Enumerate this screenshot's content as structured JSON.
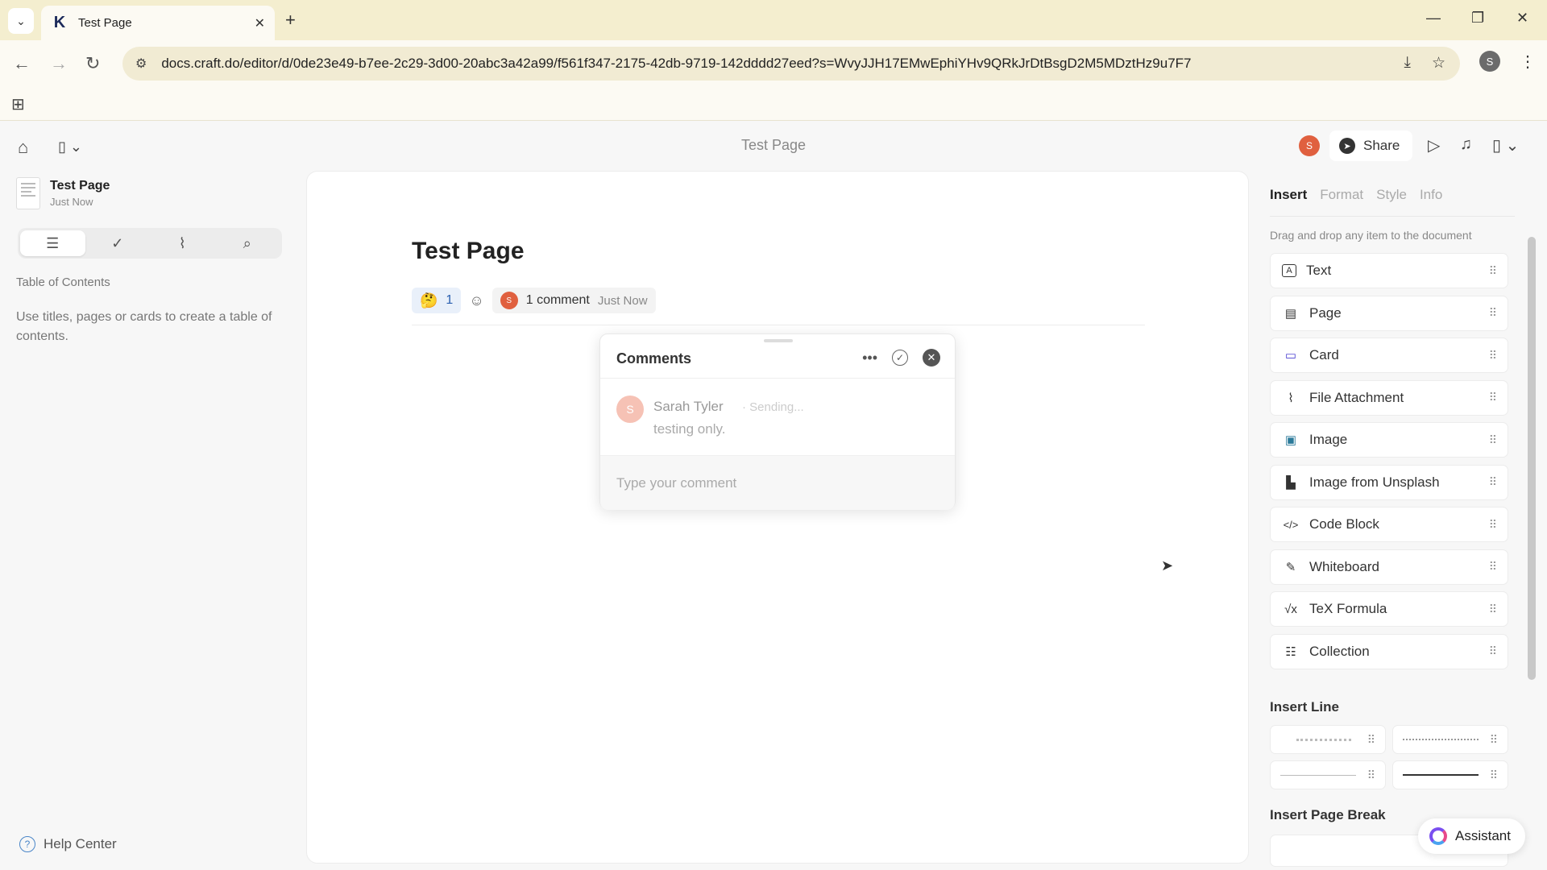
{
  "browser": {
    "tab_title": "Test Page",
    "url": "docs.craft.do/editor/d/0de23e49-b7ee-2c29-3d00-20abc3a42a99/f561f347-2175-42db-9719-142dddd27eed?s=WvyJJH17EMwEphiYHv9QRkJrDtBsgD2M5MDztHz9u7F7",
    "profile_initial": "S"
  },
  "header": {
    "title": "Test Page",
    "avatar_initial": "S",
    "share_label": "Share"
  },
  "sidebar": {
    "doc_name": "Test Page",
    "doc_time": "Just Now",
    "toc_title": "Table of Contents",
    "toc_empty": "Use titles, pages or cards to create a table of contents.",
    "help_label": "Help Center"
  },
  "document": {
    "title": "Test Page",
    "reaction_emoji": "🤔",
    "reaction_count": "1",
    "comment_avatar": "S",
    "comment_count_label": "1 comment",
    "comment_time": "Just Now"
  },
  "comments": {
    "title": "Comments",
    "author": "Sarah Tyler",
    "status": "· Sending...",
    "avatar_initial": "S",
    "body": "testing only.",
    "input_placeholder": "Type your comment"
  },
  "right_panel": {
    "tabs": [
      "Insert",
      "Format",
      "Style",
      "Info"
    ],
    "hint": "Drag and drop any item to the document",
    "items": [
      {
        "label": "Text",
        "icon": "text-icon"
      },
      {
        "label": "Page",
        "icon": "page-icon"
      },
      {
        "label": "Card",
        "icon": "card-icon"
      },
      {
        "label": "File Attachment",
        "icon": "attachment-icon"
      },
      {
        "label": "Image",
        "icon": "image-icon"
      },
      {
        "label": "Image from Unsplash",
        "icon": "unsplash-icon"
      },
      {
        "label": "Code Block",
        "icon": "code-icon"
      },
      {
        "label": "Whiteboard",
        "icon": "whiteboard-icon"
      },
      {
        "label": "TeX Formula",
        "icon": "formula-icon"
      },
      {
        "label": "Collection",
        "icon": "collection-icon"
      }
    ],
    "insert_line_title": "Insert Line",
    "insert_page_break_title": "Insert Page Break",
    "assistant_label": "Assistant"
  }
}
